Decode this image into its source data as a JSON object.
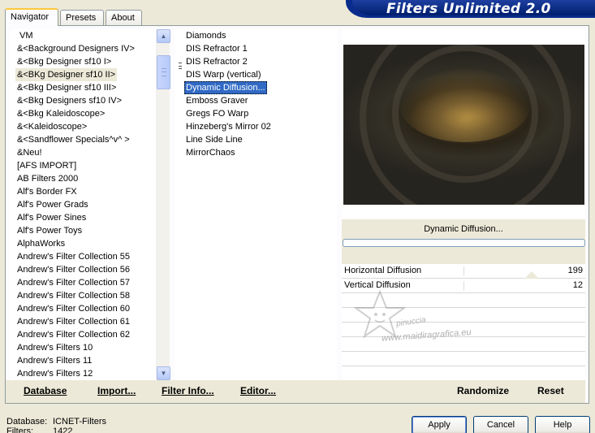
{
  "tabs": [
    "Navigator",
    "Presets",
    "About"
  ],
  "title": "Filters Unlimited 2.0",
  "categories": [
    "VM",
    "&<Background Designers IV>",
    "&<Bkg Designer sf10 I>",
    "&<BKg Designer sf10 II>",
    "&<Bkg Designer sf10 III>",
    "&<Bkg Designers sf10 IV>",
    "&<Bkg Kaleidoscope>",
    "&<Kaleidoscope>",
    "&<Sandflower Specials^v^ >",
    "&Neu!",
    "[AFS IMPORT]",
    "AB Filters 2000",
    "Alf's Border FX",
    "Alf's Power Grads",
    "Alf's Power Sines",
    "Alf's Power Toys",
    "AlphaWorks",
    "Andrew's Filter Collection 55",
    "Andrew's Filter Collection 56",
    "Andrew's Filter Collection 57",
    "Andrew's Filter Collection 58",
    "Andrew's Filter Collection 60",
    "Andrew's Filter Collection 61",
    "Andrew's Filter Collection 62",
    "Andrew's Filters 10",
    "Andrew's Filters 11",
    "Andrew's Filters 12"
  ],
  "selected_category": "&<BKg Designer sf10 II>",
  "filters": [
    "Diamonds",
    "DIS Refractor 1",
    "DIS Refractor 2",
    "DIS Warp (vertical)",
    "Dynamic Diffusion...",
    "Emboss Graver",
    "Gregs FO Warp",
    "Hinzeberg's Mirror 02",
    "Line Side Line",
    "MirrorChaos"
  ],
  "selected_filter": "Dynamic Diffusion...",
  "filter_name": "Dynamic Diffusion...",
  "params": [
    {
      "label": "Horizontal Diffusion",
      "value": "199"
    },
    {
      "label": "Vertical Diffusion",
      "value": "12"
    }
  ],
  "watermark": {
    "line1": "pinuccia",
    "line2": "www.maidiragrafica.eu"
  },
  "toolbar": {
    "database": "Database",
    "import": "Import...",
    "filter_info": "Filter Info...",
    "editor": "Editor...",
    "randomize": "Randomize",
    "reset": "Reset"
  },
  "status": {
    "database_label": "Database:",
    "database_value": "ICNET-Filters",
    "filters_label": "Filters:",
    "filters_value": "1422"
  },
  "buttons": {
    "apply": "Apply",
    "cancel": "Cancel",
    "help": "Help"
  }
}
